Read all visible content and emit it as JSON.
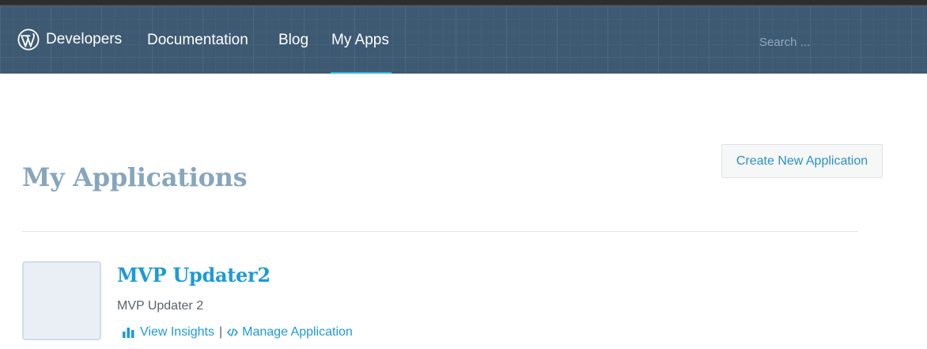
{
  "masthead": {
    "brand_label": "Developers",
    "nav": {
      "documentation": "Documentation",
      "blog": "Blog",
      "my_apps": "My Apps"
    },
    "active_nav": "my_apps",
    "search_placeholder": "Search ..."
  },
  "main": {
    "title": "My Applications",
    "create_button_label": "Create New Application",
    "applications": [
      {
        "name": "MVP Updater2",
        "description": "MVP Updater 2",
        "insights_label": "View Insights",
        "separator": "|",
        "manage_label": "Manage Application",
        "icons": {
          "insights": "bar-chart-icon",
          "manage": "code-icon"
        }
      }
    ]
  },
  "colors": {
    "masthead_bg": "#3e5a73",
    "active_underline": "#2fb4d6",
    "title": "#87a6bc",
    "link": "#1e9ad6"
  }
}
